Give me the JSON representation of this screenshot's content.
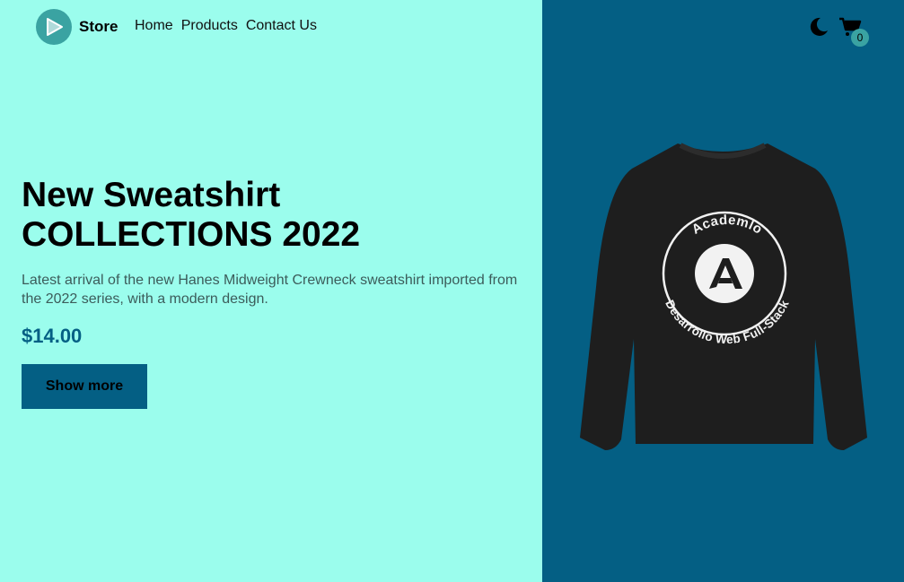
{
  "header": {
    "brand": "Store",
    "nav": [
      "Home",
      "Products",
      "Contact Us"
    ],
    "cart_count": "0"
  },
  "hero": {
    "title_line1": "New Sweatshirt",
    "title_line2": "COLLECTIONS 2022",
    "description": "Latest arrival of the new Hanes Midweight Crewneck sweatshirt imported from the 2022 series, with a modern design.",
    "price": "$14.00",
    "button_label": "Show more"
  },
  "product": {
    "print_top": "Academlo",
    "print_bottom": "Desarrollo Web Full-Stack"
  },
  "colors": {
    "left_bg": "#9bfded",
    "right_bg": "#045f84",
    "accent": "#3aa3a2"
  },
  "icons": [
    "logo-play-icon",
    "moon-icon",
    "cart-icon"
  ]
}
